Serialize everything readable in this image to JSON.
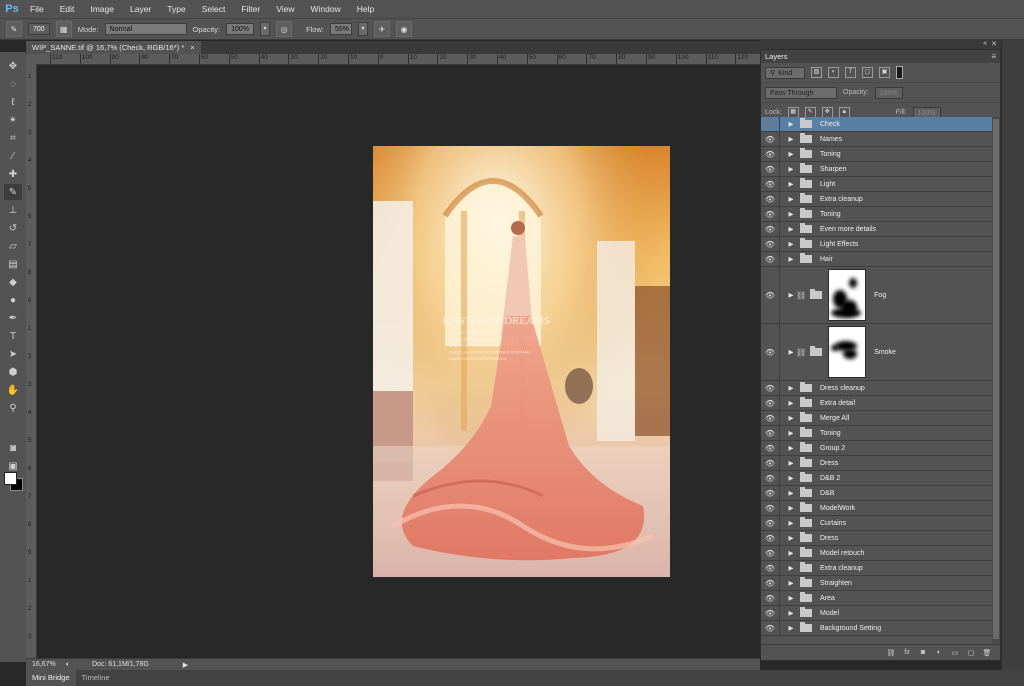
{
  "menubar": {
    "logo": "Ps",
    "items": [
      "File",
      "Edit",
      "Image",
      "Layer",
      "Type",
      "Select",
      "Filter",
      "View",
      "Window",
      "Help"
    ]
  },
  "options": {
    "brush_size": "700",
    "mode_label": "Mode:",
    "mode_value": "Normal",
    "opacity_label": "Opacity:",
    "opacity_value": "100%",
    "flow_label": "Flow:",
    "flow_value": "55%"
  },
  "document": {
    "tab_title": "WIP_SANNE.tif @ 16,7% (Check, RGB/16*) *",
    "close_glyph": "×",
    "zoom": "16,67%",
    "doc_info": "Doc: 61,1M/1,78G"
  },
  "ruler_h": [
    "110",
    "100",
    "90",
    "80",
    "70",
    "60",
    "50",
    "40",
    "30",
    "20",
    "10",
    "0",
    "10",
    "20",
    "30",
    "40",
    "50",
    "60",
    "70",
    "80",
    "90",
    "100",
    "110",
    "120",
    "130"
  ],
  "ruler_v": [
    "1",
    "2",
    "3",
    "4",
    "5",
    "6",
    "7",
    "8",
    "9",
    "1",
    "2",
    "3",
    "4",
    "5",
    "6",
    "7",
    "8",
    "9",
    "1",
    "2",
    "3"
  ],
  "artwork": {
    "title": "CASTLE OF DREAMS",
    "credit_lines": [
      "MODEL: SANNE DE BOER",
      "HAIR & MAKEUP: NAME",
      "DRESS: DESIGNER NAME",
      "PHOTO & RETOUCH: GÜNTHER STEPHAN",
      "WWW.GUNTHERSTEPHAN.DE"
    ]
  },
  "bottom_tabs": [
    "Mini Bridge",
    "Timeline"
  ],
  "layers_panel": {
    "title": "Layers",
    "filter_kind": "Kind",
    "blend_mode": "Pass Through",
    "opacity_label": "Opacity:",
    "opacity_value": "100%",
    "lock_label": "Lock:",
    "fill_label": "Fill:",
    "fill_value": "100%",
    "layers": [
      {
        "name": "Check",
        "visible": false,
        "selected": true
      },
      {
        "name": "Names",
        "visible": true
      },
      {
        "name": "Toning",
        "visible": true
      },
      {
        "name": "Sharpen",
        "visible": true
      },
      {
        "name": "Light",
        "visible": true
      },
      {
        "name": "Extra cleanup",
        "visible": true
      },
      {
        "name": "Toning",
        "visible": true
      },
      {
        "name": "Even more details",
        "visible": true
      },
      {
        "name": "Light Effects",
        "visible": true
      },
      {
        "name": "Hair",
        "visible": true
      },
      {
        "name": "Fog",
        "visible": true,
        "masked": true
      },
      {
        "name": "Smoke",
        "visible": true,
        "masked": true
      },
      {
        "name": "Dress cleanup",
        "visible": true
      },
      {
        "name": "Extra detail",
        "visible": true
      },
      {
        "name": "Merge All",
        "visible": true
      },
      {
        "name": "Toning",
        "visible": true
      },
      {
        "name": "Group 2",
        "visible": true
      },
      {
        "name": "Dress",
        "visible": true
      },
      {
        "name": "D&B 2",
        "visible": true
      },
      {
        "name": "D&B",
        "visible": true
      },
      {
        "name": "ModelWork",
        "visible": true
      },
      {
        "name": "Curtains",
        "visible": true
      },
      {
        "name": "Dress",
        "visible": true
      },
      {
        "name": "Model retouch",
        "visible": true
      },
      {
        "name": "Extra cleanup",
        "visible": true
      },
      {
        "name": "Straighten",
        "visible": true
      },
      {
        "name": "Area",
        "visible": true
      },
      {
        "name": "Model",
        "visible": true
      },
      {
        "name": "Background Setting",
        "visible": true
      }
    ],
    "footer_icons": [
      "link-icon",
      "fx-icon",
      "mask-icon",
      "adjustment-icon",
      "new-group-icon",
      "new-layer-icon",
      "trash-icon"
    ]
  },
  "colors": {
    "selected_layer": "#5a7fa5",
    "panel": "#535353",
    "workspace": "#282828"
  }
}
